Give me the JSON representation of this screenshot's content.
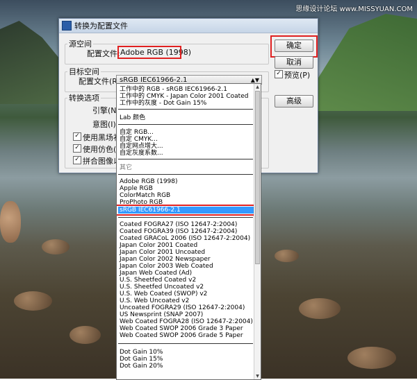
{
  "watermark": "思缘设计论坛 www.MISSYUAN.COM",
  "dialog": {
    "title": "转换为配置文件",
    "source": {
      "group_label": "源空间",
      "profile_label": "配置文件:",
      "profile_value": "Adobe RGB (1998)"
    },
    "target": {
      "group_label": "目标空间",
      "profile_label": "配置文件(R):",
      "profile_value": "sRGB IEC61966-2.1"
    },
    "conversion": {
      "group_label": "转换选项",
      "engine_label": "引擎(N):",
      "intent_label": "意图(I):",
      "options": [
        {
          "label": "使用黑场补偿",
          "checked": true
        },
        {
          "label": "使用仿色(D)",
          "checked": true
        },
        {
          "label": "拼合图像以",
          "checked": true
        }
      ]
    },
    "buttons": {
      "ok": "确定",
      "cancel": "取消",
      "preview": "预览(P)",
      "preview_checked": true,
      "advanced": "高级"
    }
  },
  "dropdown": {
    "working": [
      "工作中的 RGB - sRGB IEC61966-2.1",
      "工作中的 CMYK - Japan Color 2001 Coated",
      "工作中的灰度 - Dot Gain 15%"
    ],
    "lab": "Lab 颜色",
    "custom": [
      "自定 RGB...",
      "自定 CMYK...",
      "自定网点增大...",
      "自定灰度系数..."
    ],
    "other": "其它",
    "rgb": [
      "Adobe RGB (1998)",
      "Apple RGB",
      "ColorMatch RGB",
      "ProPhoto RGB",
      "sRGB IEC61966-2.1"
    ],
    "selected_index": 4,
    "cmyk": [
      "Coated FOGRA27 (ISO 12647-2:2004)",
      "Coated FOGRA39 (ISO 12647-2:2004)",
      "Coated GRACoL 2006 (ISO 12647-2:2004)",
      "Japan Color 2001 Coated",
      "Japan Color 2001 Uncoated",
      "Japan Color 2002 Newspaper",
      "Japan Color 2003 Web Coated",
      "Japan Web Coated (Ad)",
      "U.S. Sheetfed Coated v2",
      "U.S. Sheetfed Uncoated v2",
      "U.S. Web Coated (SWOP) v2",
      "U.S. Web Uncoated v2",
      "Uncoated FOGRA29 (ISO 12647-2:2004)",
      "US Newsprint (SNAP 2007)",
      "Web Coated FOGRA28 (ISO 12647-2:2004)",
      "Web Coated SWOP 2006 Grade 3 Paper",
      "Web Coated SWOP 2006 Grade 5 Paper"
    ],
    "gray": [
      "Dot Gain 10%",
      "Dot Gain 15%",
      "Dot Gain 20%"
    ]
  },
  "colors": {
    "highlight": "#3399ff",
    "annotation": "#e02020"
  }
}
